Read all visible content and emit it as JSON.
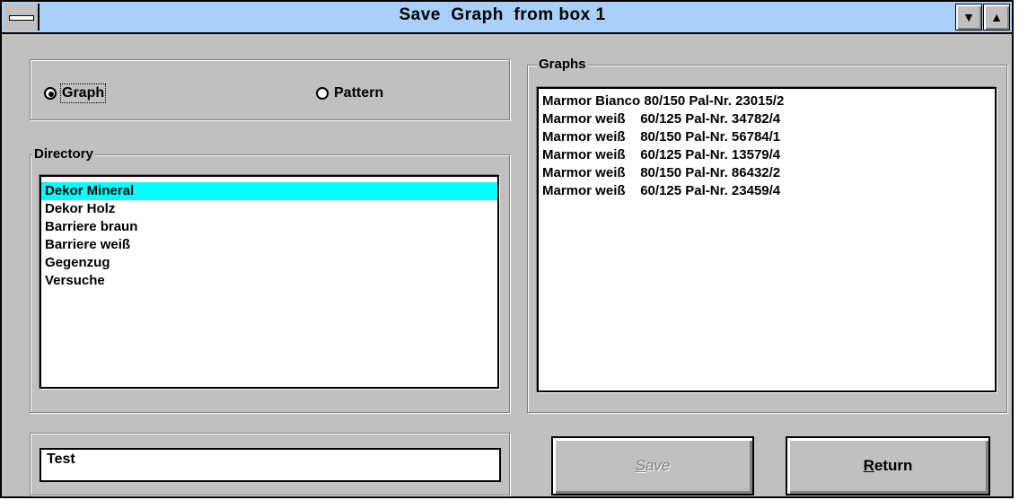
{
  "window": {
    "title": "Save  Graph  from box 1"
  },
  "mode": {
    "graph_label": "Graph",
    "pattern_label": "Pattern",
    "selected": "Graph"
  },
  "directory": {
    "label": "Directory",
    "items": [
      "Dekor Mineral",
      "Dekor Holz",
      "Barriere braun",
      "Barriere weiß",
      "Gegenzug",
      "Versuche"
    ],
    "selected_index": 0
  },
  "graphs": {
    "label": "Graphs",
    "items": [
      "Marmor Bianco 80/150 Pal-Nr. 23015/2",
      "Marmor weiß    60/125 Pal-Nr. 34782/4",
      "Marmor weiß    80/150 Pal-Nr. 56784/1",
      "Marmor weiß    60/125 Pal-Nr. 13579/4",
      "Marmor weiß    80/150 Pal-Nr. 86432/2",
      "Marmor weiß    60/125 Pal-Nr. 23459/4"
    ]
  },
  "filename": {
    "value": "Test"
  },
  "buttons": {
    "save_first": "S",
    "save_rest": "ave",
    "save_enabled": false,
    "return_first": "R",
    "return_rest": "eturn"
  },
  "colors": {
    "titlebar": "#a8d0f8",
    "selection": "#00ffff",
    "face": "#c0c0c0"
  }
}
